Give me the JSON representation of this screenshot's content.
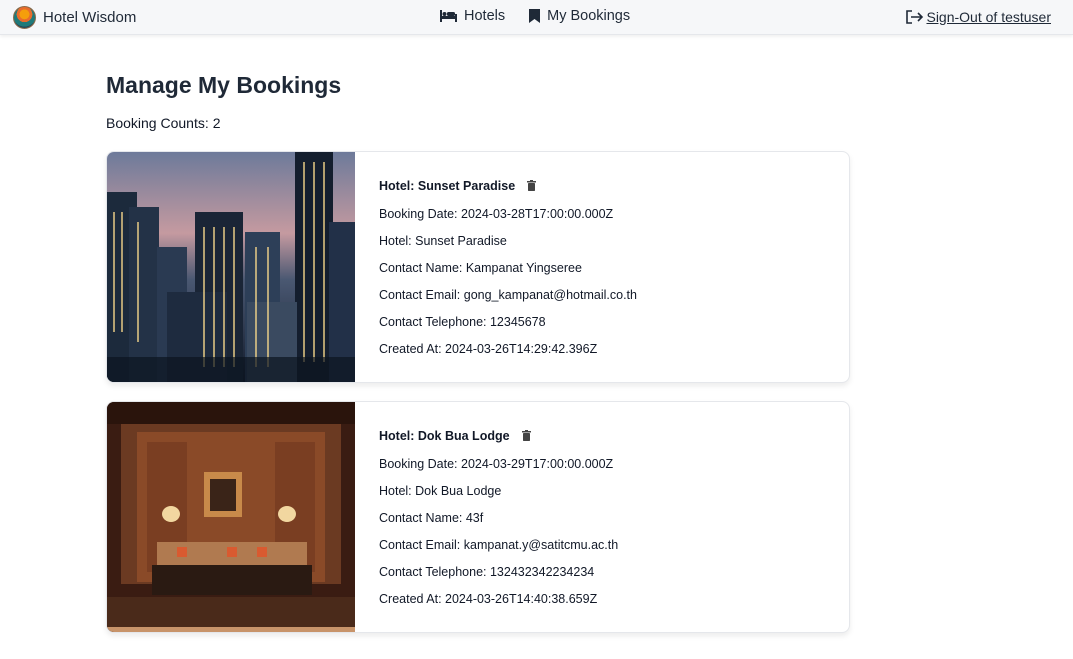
{
  "nav": {
    "brand": "Hotel Wisdom",
    "links": [
      {
        "label": "Hotels",
        "icon": "bed-icon"
      },
      {
        "label": "My Bookings",
        "icon": "bookmark-icon"
      }
    ],
    "signout": "Sign-Out of testuser"
  },
  "page": {
    "title": "Manage My Bookings",
    "count_label": "Booking Counts:",
    "count_value": "2"
  },
  "bookings": [
    {
      "header": "Hotel: Sunset Paradise",
      "booking_date": "Booking Date: 2024-03-28T17:00:00.000Z",
      "hotel": "Hotel: Sunset Paradise",
      "contact_name": "Contact Name: Kampanat Yingseree",
      "contact_email": "Contact Email: gong_kampanat@hotmail.co.th",
      "contact_tel": "Contact Telephone: 12345678",
      "created_at": "Created At: 2024-03-26T14:29:42.396Z"
    },
    {
      "header": "Hotel: Dok Bua Lodge",
      "booking_date": "Booking Date: 2024-03-29T17:00:00.000Z",
      "hotel": "Hotel: Dok Bua Lodge",
      "contact_name": "Contact Name: 43f",
      "contact_email": "Contact Email: kampanat.y@satitcmu.ac.th",
      "contact_tel": "Contact Telephone: 132432342234234",
      "created_at": "Created At: 2024-03-26T14:40:38.659Z"
    }
  ],
  "colors": {
    "navbar_bg": "#f6f7f9",
    "text": "#111827",
    "card_border": "#e5e7eb"
  }
}
